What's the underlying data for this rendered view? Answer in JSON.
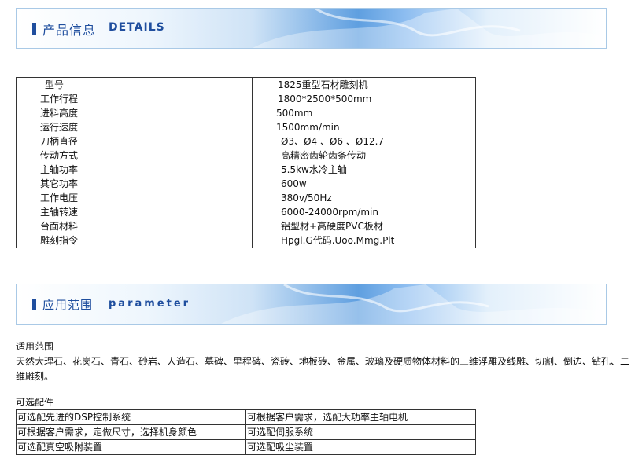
{
  "banner1": {
    "title_cn": "产品信息",
    "title_en": "DETAILS"
  },
  "spec_rows": [
    {
      "label": "型号",
      "value": "1825重型石材雕刻机"
    },
    {
      "label": "工作行程",
      "value": "1800*2500*500mm"
    },
    {
      "label": "进料高度",
      "value": "500mm"
    },
    {
      "label": "运行速度",
      "value": "1500mm/min"
    },
    {
      "label": "刀柄直径",
      "value": "Ø3、Ø4 、Ø6 、Ø12.7"
    },
    {
      "label": "传动方式",
      "value": "高精密齿轮齿条传动"
    },
    {
      "label": "主轴功率",
      "value": "5.5kw水冷主轴"
    },
    {
      "label": "其它功率",
      "value": "600w"
    },
    {
      "label": "工作电压",
      "value": "380v/50Hz"
    },
    {
      "label": "主轴转速",
      "value": "6000-24000rpm/min"
    },
    {
      "label": "台面材料",
      "value": "铝型材+高硬度PVC板材"
    },
    {
      "label": "雕刻指令",
      "value": "Hpgl.G代码.Uoo.Mmg.Plt"
    }
  ],
  "banner2": {
    "title_cn": "应用范围",
    "title_en": "parameter"
  },
  "scope": {
    "heading": "适用范围",
    "text": "天然大理石、花岗石、青石、砂岩、人造石、墓碑、里程碑、瓷砖、地板砖、金属、玻璃及硬质物体材料的三维浮雕及线雕、切割、倒边、钻孔、二维雕刻。"
  },
  "options": {
    "heading": "可选配件",
    "rows": [
      [
        "可选配先进的DSP控制系统",
        "可根据客户需求，选配大功率主轴电机"
      ],
      [
        "可根据客户需求，定做尺寸，选择机身颜色",
        "可选配伺服系统"
      ],
      [
        "可选配真空吸附装置",
        "可选配吸尘装置"
      ]
    ]
  }
}
